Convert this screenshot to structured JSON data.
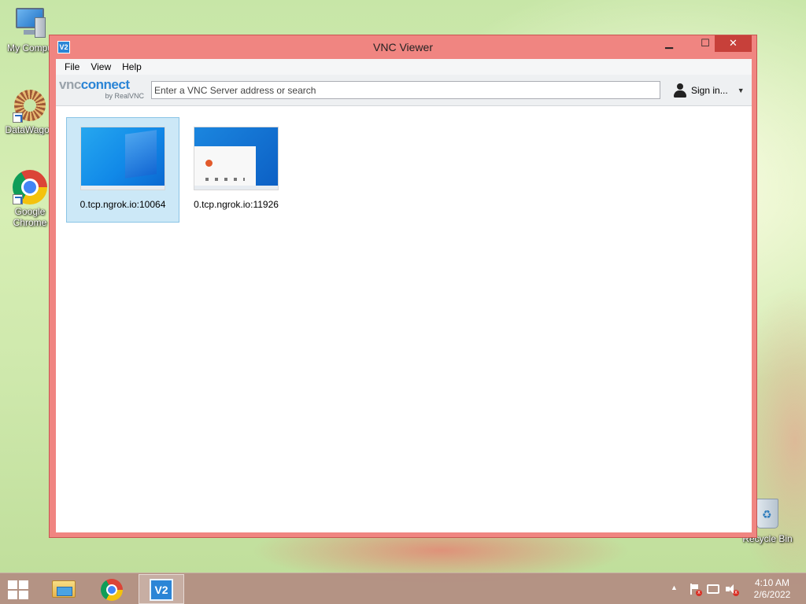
{
  "desktop": {
    "icons": [
      {
        "label": "My Compu",
        "icon": "computer-icon"
      },
      {
        "label": "DataWagon",
        "icon": "datawagon-icon"
      },
      {
        "label": "Google Chrome",
        "icon": "chrome-icon"
      },
      {
        "label": "Recycle Bin",
        "icon": "recycle-bin-icon"
      }
    ]
  },
  "window": {
    "app_icon_text": "V2",
    "title": "VNC Viewer",
    "controls": {
      "minimize": "▁",
      "maximize": "☐",
      "close": "✕"
    },
    "menu": [
      "File",
      "View",
      "Help"
    ],
    "brand": {
      "vnc": "vnc",
      "connect": "connect",
      "sub": "by RealVNC"
    },
    "search": {
      "value": "",
      "placeholder": "Enter a VNC Server address or search"
    },
    "sign_in": {
      "label": "Sign in...",
      "icon": "user-icon",
      "dropdown": "▼"
    },
    "connections": [
      {
        "label": "0.tcp.ngrok.io:10064",
        "selected": true
      },
      {
        "label": "0.tcp.ngrok.io:11926",
        "selected": false
      }
    ]
  },
  "taskbar": {
    "items": [
      {
        "name": "file-explorer",
        "active": false
      },
      {
        "name": "google-chrome",
        "active": false
      },
      {
        "name": "vnc-viewer",
        "active": true,
        "text": "V2"
      }
    ],
    "tray_arrow": "▲",
    "time": "4:10 AM",
    "date": "2/6/2022"
  }
}
